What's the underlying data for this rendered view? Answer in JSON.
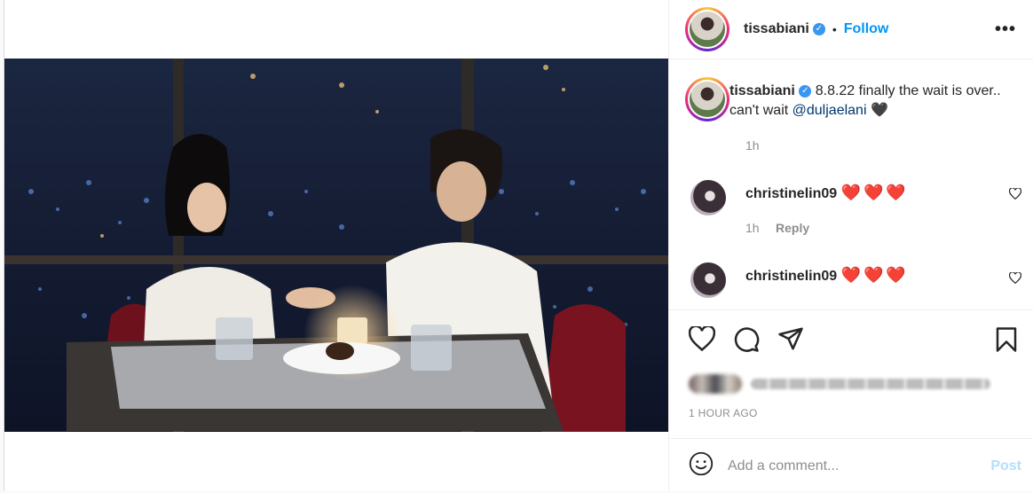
{
  "post": {
    "author": "tissabiani",
    "verified_icon": "verified-badge-icon",
    "follow_label": "Follow",
    "separator": "•",
    "more_label": "•••",
    "caption": {
      "username": "tissabiani",
      "text_before": "8.8.22 finally the wait is over.. can't wait ",
      "mention": "@duljaelani",
      "emoji": "🖤",
      "time": "1h"
    },
    "comments": [
      {
        "username": "christinelin09",
        "text": "❤️❤️❤️",
        "time": "1h",
        "reply_label": "Reply"
      },
      {
        "username": "christinelin09",
        "text": "❤️❤️❤️"
      }
    ],
    "timestamp": "1 HOUR AGO",
    "add_comment_placeholder": "Add a comment...",
    "post_label": "Post"
  },
  "colors": {
    "link": "#0095f6",
    "post_disabled": "#b2dffc",
    "heart": "#ed2f3c"
  },
  "icons": [
    "heart-icon",
    "comment-icon",
    "share-icon",
    "bookmark-icon",
    "emoji-icon",
    "user-tag-icon",
    "more-options-icon"
  ]
}
